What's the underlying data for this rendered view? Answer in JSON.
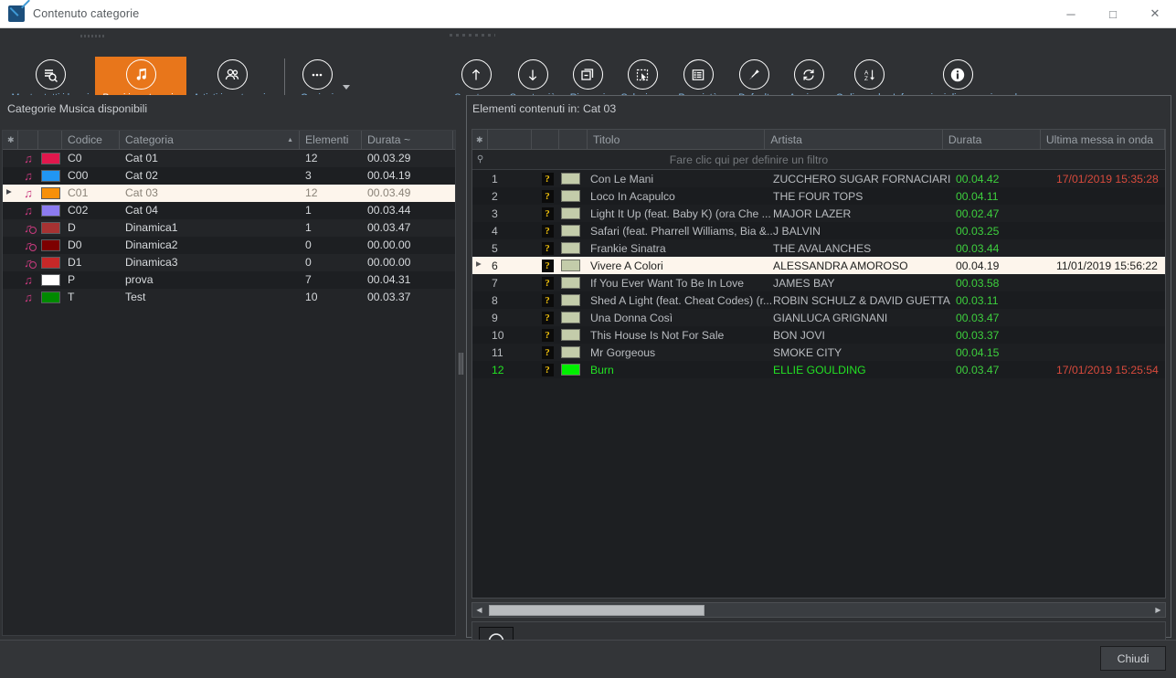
{
  "window": {
    "title": "Contenuto categorie",
    "icon": "app-logo-icon",
    "minimize": "─",
    "maximize": "□",
    "close": "✕"
  },
  "ribbon": {
    "left_group": [
      {
        "label": "Mostra tutti i brani",
        "icon": "list-search-icon",
        "active": false
      },
      {
        "label": "Brani in categorie",
        "icon": "music-notes-icon",
        "active": true
      },
      {
        "label": "Artisti in categorie",
        "icon": "people-icon",
        "active": false
      },
      {
        "label": "Opzioni",
        "icon": "ellipsis-icon",
        "active": false
      }
    ],
    "right_group": [
      {
        "label": "Sposta su",
        "icon": "arrow-up-icon"
      },
      {
        "label": "Sposta giù",
        "icon": "arrow-down-icon"
      },
      {
        "label": "Rimuovi",
        "icon": "remove-window-icon"
      },
      {
        "label": "Seleziona",
        "icon": "select-cursor-icon"
      },
      {
        "label": "Proprietà",
        "icon": "list-properties-icon"
      },
      {
        "label": "Default",
        "icon": "pin-icon"
      },
      {
        "label": "Aggiorna",
        "icon": "refresh-icon"
      },
      {
        "label": "Ordina colonne",
        "icon": "sort-az-icon"
      },
      {
        "label": "Informazioni di messa in onda",
        "icon": "info-icon"
      }
    ],
    "accent_color": "#e8761b"
  },
  "left": {
    "caption": "Categorie Musica disponibili",
    "columns": [
      "",
      "",
      "",
      "Codice",
      "Categoria",
      "Elementi",
      "Durata ~"
    ],
    "sort_column": "Categoria",
    "sort_direction": "asc",
    "rows": [
      {
        "icon": "music-note-icon",
        "color": "#e0174c",
        "codice": "C0",
        "categoria": "Cat 01",
        "elementi": "12",
        "durata": "00.03.29",
        "selected": false
      },
      {
        "icon": "music-note-icon",
        "color": "#2196f3",
        "codice": "C00",
        "categoria": "Cat 02",
        "elementi": "3",
        "durata": "00.04.19",
        "selected": false
      },
      {
        "icon": "music-note-icon",
        "color": "#f79009",
        "codice": "C01",
        "categoria": "Cat 03",
        "elementi": "12",
        "durata": "00.03.49",
        "selected": true
      },
      {
        "icon": "music-note-icon",
        "color": "#8c7bf0",
        "codice": "C02",
        "categoria": "Cat 04",
        "elementi": "1",
        "durata": "00.03.44",
        "selected": false
      },
      {
        "icon": "music-note-clock-icon",
        "color": "#a63232",
        "codice": "D",
        "categoria": "Dinamica1",
        "elementi": "1",
        "durata": "00.03.47",
        "selected": false
      },
      {
        "icon": "music-note-clock-icon",
        "color": "#7d0000",
        "codice": "D0",
        "categoria": "Dinamica2",
        "elementi": "0",
        "durata": "00.00.00",
        "selected": false
      },
      {
        "icon": "music-note-clock-icon",
        "color": "#c62828",
        "codice": "D1",
        "categoria": "Dinamica3",
        "elementi": "0",
        "durata": "00.00.00",
        "selected": false
      },
      {
        "icon": "music-note-icon",
        "color": "#ffffff",
        "codice": "P",
        "categoria": "prova",
        "elementi": "7",
        "durata": "00.04.31",
        "selected": false
      },
      {
        "icon": "music-note-icon",
        "color": "#008a00",
        "codice": "T",
        "categoria": "Test",
        "elementi": "10",
        "durata": "00.03.37",
        "selected": false
      }
    ]
  },
  "right": {
    "caption": "Elementi contenuti in: Cat 03",
    "columns": [
      "",
      "",
      "",
      "",
      "Titolo",
      "Artista",
      "Durata",
      "Ultima messa in onda"
    ],
    "filter_placeholder": "Fare clic qui per definire un filtro",
    "rows": [
      {
        "n": "1",
        "flag": "?",
        "color": "#c3ccaa",
        "titolo": "Con Le Mani",
        "artista": "ZUCCHERO SUGAR FORNACIARI",
        "durata": "00.04.42",
        "ultima": "17/01/2019 15:35:28",
        "selected": false,
        "highlight": false
      },
      {
        "n": "2",
        "flag": "?",
        "color": "#c3ccaa",
        "titolo": "Loco In Acapulco",
        "artista": "THE FOUR TOPS",
        "durata": "00.04.11",
        "ultima": "",
        "selected": false,
        "highlight": false
      },
      {
        "n": "3",
        "flag": "?",
        "color": "#c3ccaa",
        "titolo": "Light It Up (feat. Baby K) (ora Che ...",
        "artista": "MAJOR LAZER",
        "durata": "00.02.47",
        "ultima": "",
        "selected": false,
        "highlight": false
      },
      {
        "n": "4",
        "flag": "?",
        "color": "#c3ccaa",
        "titolo": "Safari (feat. Pharrell Williams, Bia &...",
        "artista": "J BALVIN",
        "durata": "00.03.25",
        "ultima": "",
        "selected": false,
        "highlight": false
      },
      {
        "n": "5",
        "flag": "?",
        "color": "#c3ccaa",
        "titolo": "Frankie Sinatra",
        "artista": "THE AVALANCHES",
        "durata": "00.03.44",
        "ultima": "",
        "selected": false,
        "highlight": false
      },
      {
        "n": "6",
        "flag": "?",
        "color": "#c3ccaa",
        "titolo": "Vivere A Colori",
        "artista": "ALESSANDRA AMOROSO",
        "durata": "00.04.19",
        "ultima": "11/01/2019 15:56:22",
        "selected": true,
        "highlight": false
      },
      {
        "n": "7",
        "flag": "?",
        "color": "#c3ccaa",
        "titolo": "If You Ever Want To Be In Love",
        "artista": "JAMES BAY",
        "durata": "00.03.58",
        "ultima": "",
        "selected": false,
        "highlight": false
      },
      {
        "n": "8",
        "flag": "?",
        "color": "#c3ccaa",
        "titolo": "Shed A Light (feat. Cheat Codes) (r...",
        "artista": "ROBIN SCHULZ & DAVID GUETTA",
        "durata": "00.03.11",
        "ultima": "",
        "selected": false,
        "highlight": false
      },
      {
        "n": "9",
        "flag": "?",
        "color": "#c3ccaa",
        "titolo": "Una Donna Così",
        "artista": "GIANLUCA GRIGNANI",
        "durata": "00.03.47",
        "ultima": "",
        "selected": false,
        "highlight": false
      },
      {
        "n": "10",
        "flag": "?",
        "color": "#c3ccaa",
        "titolo": "This House Is Not For Sale",
        "artista": "BON JOVI",
        "durata": "00.03.37",
        "ultima": "",
        "selected": false,
        "highlight": false
      },
      {
        "n": "11",
        "flag": "?",
        "color": "#c3ccaa",
        "titolo": "Mr Gorgeous",
        "artista": "SMOKE CITY",
        "durata": "00.04.15",
        "ultima": "",
        "selected": false,
        "highlight": false
      },
      {
        "n": "12",
        "flag": "?",
        "color": "#00ef00",
        "titolo": "Burn",
        "artista": "ELLIE GOULDING",
        "durata": "00.03.47",
        "ultima": "17/01/2019 15:25:54",
        "selected": false,
        "highlight": true
      }
    ],
    "preview_button": "headphones-icon"
  },
  "footer": {
    "close_label": "Chiudi"
  }
}
